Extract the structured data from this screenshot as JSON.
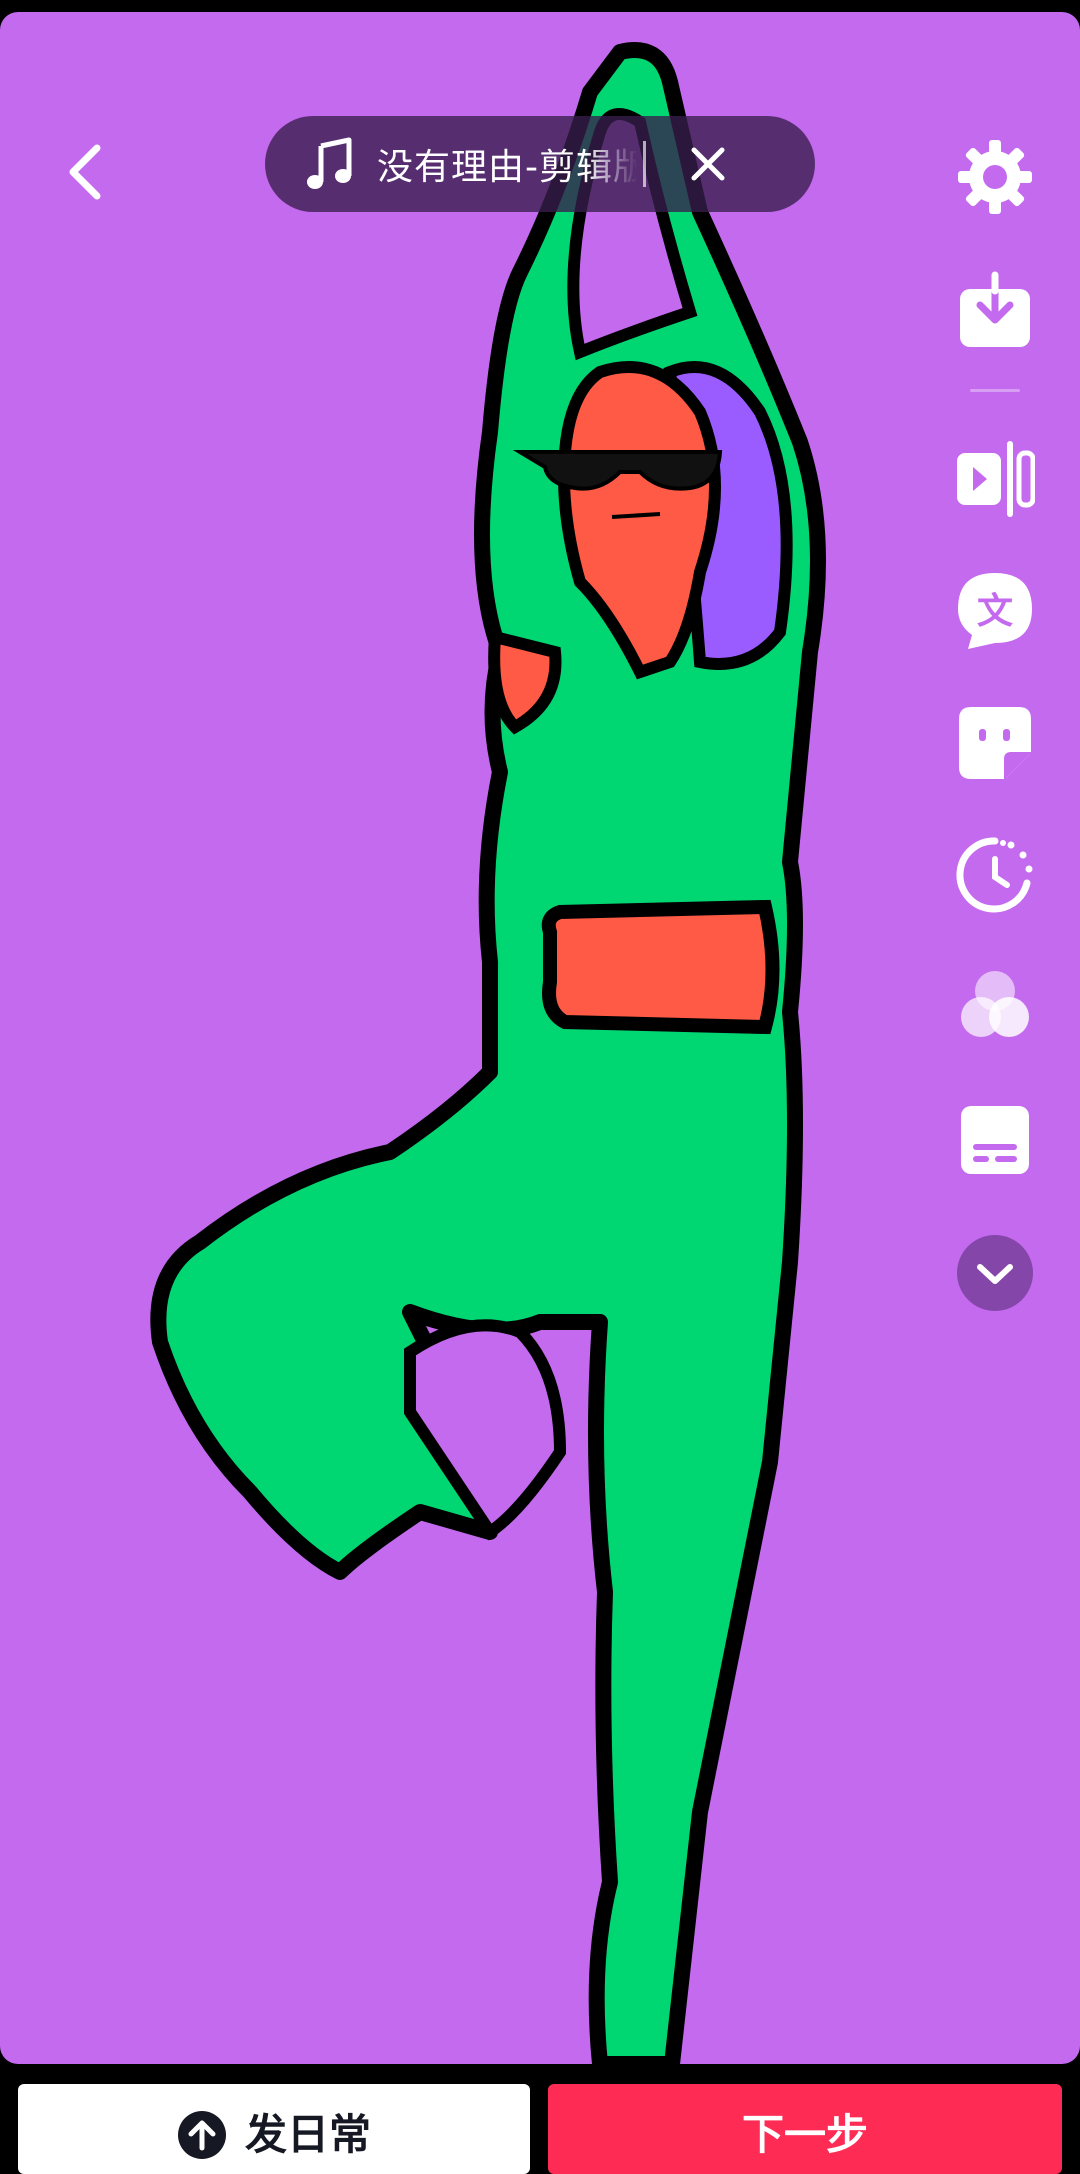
{
  "colors": {
    "background": "#c46aef",
    "figure_green": "#00d672",
    "skin_red": "#ff5a46",
    "hair_purple": "#9b5cff",
    "outline": "#000000",
    "next_button": "#fe2c55",
    "daily_button": "#ffffff"
  },
  "header": {
    "back_icon": "chevron-left-icon",
    "music": {
      "icon": "music-note-icon",
      "title": "没有理由-剪辑版",
      "close_icon": "close-icon"
    }
  },
  "sidebar": {
    "items": [
      {
        "icon": "settings-gear-icon"
      },
      {
        "icon": "download-icon"
      },
      {
        "icon": "video-clip-icon"
      },
      {
        "icon": "text-icon"
      },
      {
        "icon": "sticker-icon"
      },
      {
        "icon": "timer-icon"
      },
      {
        "icon": "filter-icon"
      },
      {
        "icon": "captions-icon"
      },
      {
        "icon": "expand-more-icon"
      }
    ]
  },
  "footer": {
    "daily_label": "发日常",
    "daily_icon": "upload-arrow-icon",
    "next_label": "下一步"
  }
}
